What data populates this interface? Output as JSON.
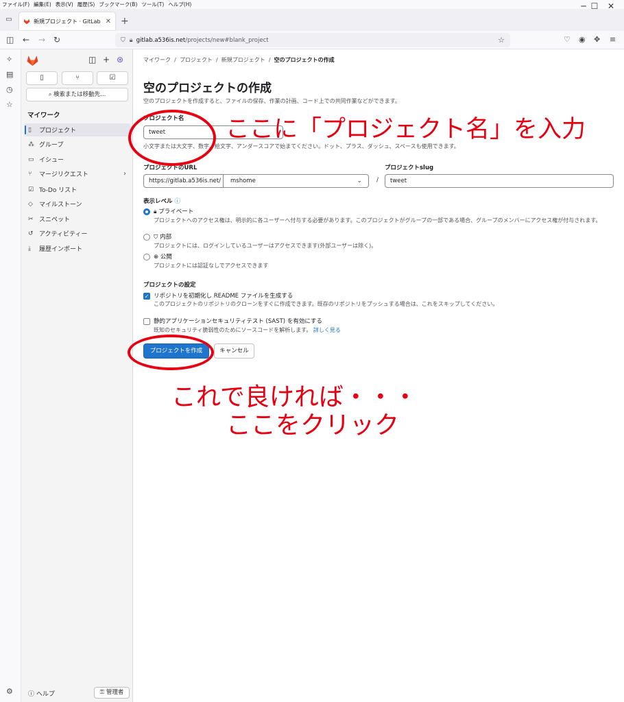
{
  "browser": {
    "menu": [
      "ファイル(F)",
      "編集(E)",
      "表示(V)",
      "履歴(S)",
      "ブックマーク(B)",
      "ツール(T)",
      "ヘルプ(H)"
    ],
    "tab_title": "新規プロジェクト · GitLab",
    "url_host": "gitlab.a536is.net",
    "url_path": "/projects/new#blank_project"
  },
  "sidebar": {
    "search_label": "検索または移動先...",
    "section_title": "マイワーク",
    "items": [
      {
        "label": "プロジェクト",
        "icon": "project-icon",
        "active": true
      },
      {
        "label": "グループ",
        "icon": "group-icon"
      },
      {
        "label": "イシュー",
        "icon": "issue-icon"
      },
      {
        "label": "マージリクエスト",
        "icon": "merge-request-icon",
        "has_chevron": true
      },
      {
        "label": "To-Do リスト",
        "icon": "todo-icon"
      },
      {
        "label": "マイルストーン",
        "icon": "milestone-icon"
      },
      {
        "label": "スニペット",
        "icon": "snippet-icon"
      },
      {
        "label": "アクティビティー",
        "icon": "activity-icon"
      },
      {
        "label": "履歴インポート",
        "icon": "import-icon"
      }
    ],
    "help_label": "ヘルプ",
    "admin_label": "管理者"
  },
  "breadcrumb": [
    "マイワーク",
    "プロジェクト",
    "新規プロジェクト",
    "空のプロジェクトの作成"
  ],
  "page": {
    "title": "空のプロジェクトの作成",
    "description": "空のプロジェクトを作成すると、ファイルの保存、作業の計画、コード上での共同作業などができます。",
    "project_name_label": "プロジェクト名",
    "project_name_value": "tweet",
    "project_name_hint": "小文字または大文字、数字、絵文字、アンダースコアで始まてください。ドット、プラス、ダッシュ、スペースも使用できます。",
    "url_label": "プロジェクトのURL",
    "url_prefix": "https://gitlab.a536is.net/",
    "namespace_value": "mshome",
    "slash": "/",
    "slug_label": "プロジェクトslug",
    "slug_value": "tweet",
    "visibility_label": "表示レベル",
    "visibility": [
      {
        "title": "プライベート",
        "desc": "プロジェクトへのアクセス権は、明示的に各ユーザーへ付与する必要があります。このプロジェクトがグループの一部である場合、グループのメンバーにアクセス権が付与されます。",
        "checked": true
      },
      {
        "title": "内部",
        "desc": "プロジェクトには、ログインしているユーザーはアクセスできます(外部ユーザーは除く)。",
        "checked": false
      },
      {
        "title": "公開",
        "desc": "プロジェクトには認証なしでアクセスできます",
        "checked": false
      }
    ],
    "settings_label": "プロジェクトの設定",
    "readme_title": "リポジトリを初期化し README ファイルを生成する",
    "readme_desc": "このプロジェクトのリポジトリのクローンをすぐに作成できます。既存のリポジトリをプッシュする場合は、これをスキップしてください。",
    "sast_title": "静的アプリケーションセキュリティテスト (SAST) を有効にする",
    "sast_desc": "既知のセキュリティ脆弱性のためにソースコードを解析します。",
    "sast_link": "詳しく見る",
    "create_button": "プロジェクトを作成",
    "cancel_button": "キャンセル"
  },
  "annotations": {
    "top": "ここに「プロジェクト名」を入力",
    "bottom_line1": "これで良ければ・・・",
    "bottom_line2": "ここをクリック",
    "color": "#e60012"
  },
  "colors": {
    "accent": "#1f75cb",
    "annotation": "#e60012"
  }
}
